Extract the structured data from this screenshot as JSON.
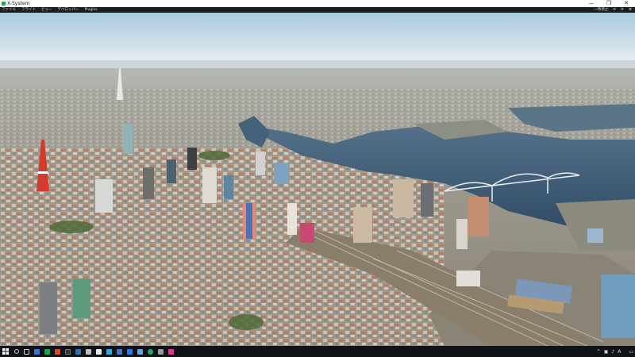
{
  "window": {
    "title": "X-System",
    "controls": {
      "minimize": "—",
      "maximize": "❐",
      "close": "✕"
    }
  },
  "menu": {
    "items": [
      "ファイル",
      "フライト",
      "ビュー",
      "デベロッパー",
      "Plugins"
    ],
    "right_items": [
      "一時停止",
      "⟳",
      "⟳",
      "⚙"
    ]
  },
  "scene": {
    "description_colors": {
      "sky_top": "#bfd8ea",
      "sky_horizon": "#e9eef0",
      "water": "#34516b",
      "city": "#9a9384"
    }
  },
  "taskbar": {
    "icons": [
      {
        "name": "windows-start-icon",
        "color": "#ffffff"
      },
      {
        "name": "search-icon",
        "color": "#cfcfcf"
      },
      {
        "name": "task-view-icon",
        "color": "#cfcfcf"
      },
      {
        "name": "app-icon-1",
        "color": "#3a6fd8"
      },
      {
        "name": "app-icon-2",
        "color": "#1f9e55"
      },
      {
        "name": "app-icon-3",
        "color": "#d64a2c"
      },
      {
        "name": "app-icon-4",
        "color": "#333333"
      },
      {
        "name": "app-icon-5",
        "color": "#2f6fb5"
      },
      {
        "name": "app-icon-6",
        "color": "#bfbfbf"
      },
      {
        "name": "app-icon-7",
        "color": "#e8e8e8"
      },
      {
        "name": "app-icon-8",
        "color": "#3aa6d8"
      },
      {
        "name": "app-icon-9",
        "color": "#4676c4"
      },
      {
        "name": "app-icon-10",
        "color": "#2b7bd6"
      },
      {
        "name": "app-icon-11",
        "color": "#6aa0e0"
      },
      {
        "name": "app-icon-12",
        "color": "#29a36a"
      },
      {
        "name": "app-icon-13",
        "color": "#9a9a9a"
      },
      {
        "name": "app-icon-14",
        "color": "#d83a8e"
      }
    ],
    "tray": {
      "glyphs": [
        "^",
        "▣",
        "♪",
        "A"
      ],
      "time": "",
      "date": ""
    }
  }
}
